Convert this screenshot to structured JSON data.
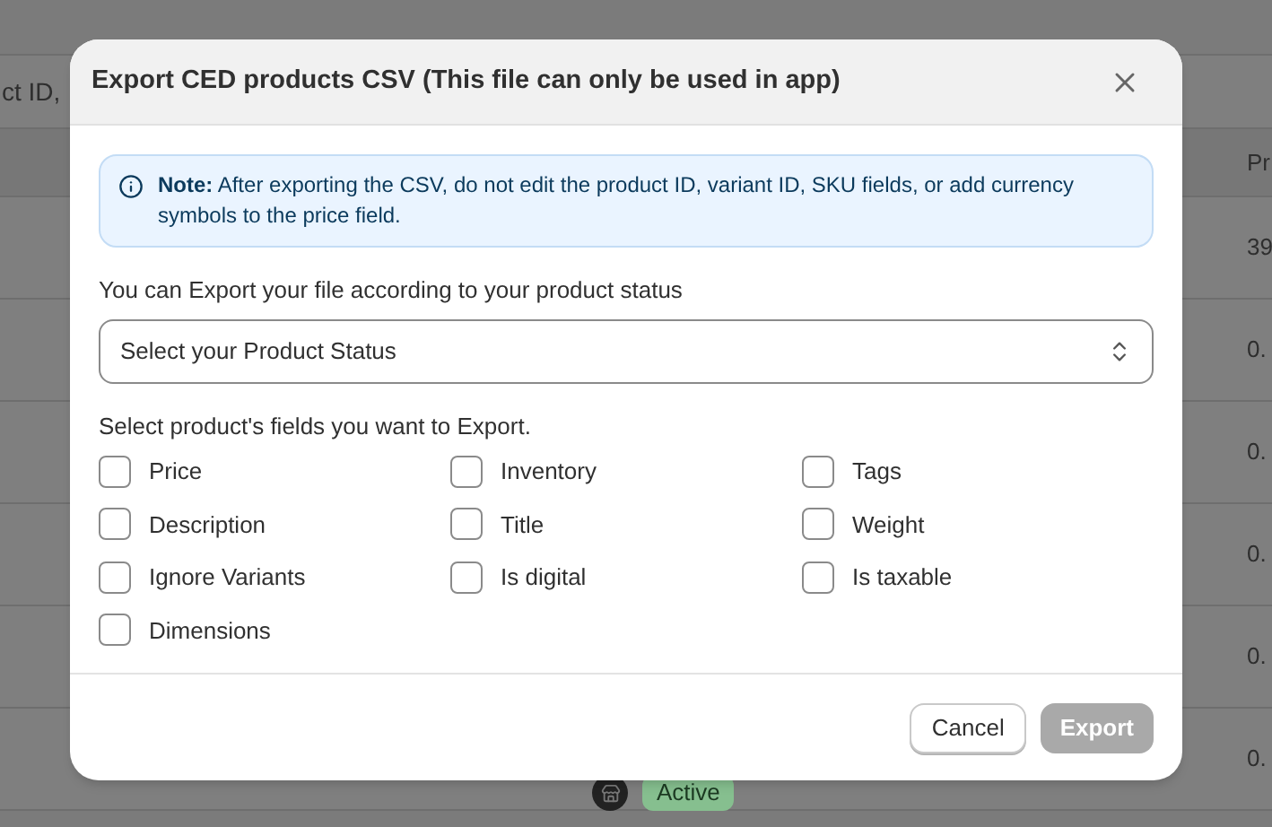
{
  "background": {
    "toolbar_text": "ct ID,",
    "column_header": "Pr",
    "rows": [
      {
        "price": "39"
      },
      {
        "price": "0."
      },
      {
        "price": "0."
      },
      {
        "price": "0."
      },
      {
        "price": "0."
      },
      {
        "price": "0.",
        "status": "Active",
        "color": "#86bf8f"
      }
    ]
  },
  "dialog": {
    "title": "Export CED products CSV (This file can only be used in app)",
    "note": "**Note:** After exporting the CSV, do not edit the product ID, variant ID, SKU fields, or add currency symbols to the price field.",
    "status_label": "You can Export your file according to your product status",
    "status_select": {
      "placeholder": "Select your Product Status"
    },
    "fields_label": "Select product's fields you want to Export.",
    "fields": [
      {
        "label": "Price",
        "checked": false
      },
      {
        "label": "Inventory",
        "checked": false
      },
      {
        "label": "Tags",
        "checked": false
      },
      {
        "label": "Description",
        "checked": false
      },
      {
        "label": "Title",
        "checked": false
      },
      {
        "label": "Weight",
        "checked": false
      },
      {
        "label": "Ignore Variants",
        "checked": false
      },
      {
        "label": "Is digital",
        "checked": false
      },
      {
        "label": "Is taxable",
        "checked": false
      },
      {
        "label": "Dimensions",
        "checked": false
      }
    ],
    "buttons": [
      {
        "label": "Cancel",
        "kind": "secondary",
        "disabled": false
      },
      {
        "label": "Export",
        "kind": "primary",
        "disabled": true
      }
    ]
  }
}
